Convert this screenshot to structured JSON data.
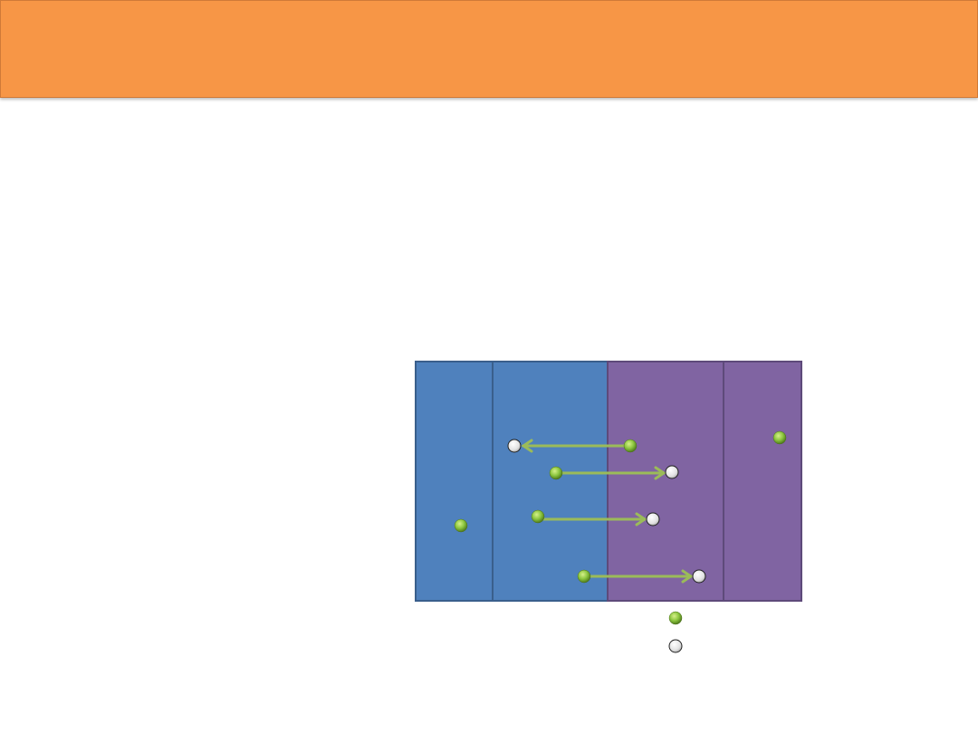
{
  "slide": {
    "title": "",
    "accent_color": "#f79646"
  },
  "diagram": {
    "regions": [
      {
        "name": "left",
        "color": "#4f81bd",
        "border": "#3a5f8c"
      },
      {
        "name": "right",
        "color": "#8064a2",
        "border": "#5e4a7a"
      }
    ],
    "point_colors": {
      "green": "#8cc63f",
      "white": "#d9d9d9"
    },
    "arrow_color": "#9bbb59",
    "transitions": [
      {
        "from": "green",
        "to": "white",
        "direction": "left"
      },
      {
        "from": "green",
        "to": "white",
        "direction": "right"
      },
      {
        "from": "green",
        "to": "white",
        "direction": "right"
      },
      {
        "from": "green",
        "to": "white",
        "direction": "right"
      }
    ],
    "standalone_points": [
      "green",
      "green"
    ],
    "legend": [
      {
        "icon": "green-dot"
      },
      {
        "icon": "white-dot"
      }
    ]
  }
}
